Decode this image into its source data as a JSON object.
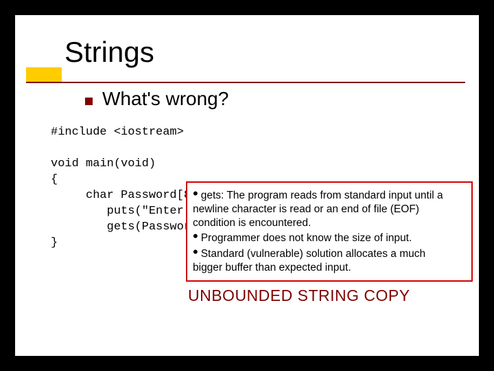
{
  "title": "Strings",
  "subtitle": "What's wrong?",
  "code": {
    "line1": "#include <iostream>",
    "blank1": "",
    "line2": "void main(void)",
    "line3": "{",
    "line4": "     char Password[8",
    "line5": "        puts(\"Enter ",
    "line6": "        gets(Passwor",
    "line7": "}"
  },
  "callout": {
    "b1_label": "gets:",
    "b1_text_a": " The program reads from standard input until a",
    "b1_text_b": "newline character is read or an end of file (EOF)",
    "b1_text_c": "condition is encountered.",
    "b2_text": "Programmer does not know the size of input.",
    "b3_text_a": "Standard (vulnerable) solution allocates a much",
    "b3_text_b": "bigger buffer than expected input."
  },
  "headline": "UNBOUNDED STRING COPY"
}
